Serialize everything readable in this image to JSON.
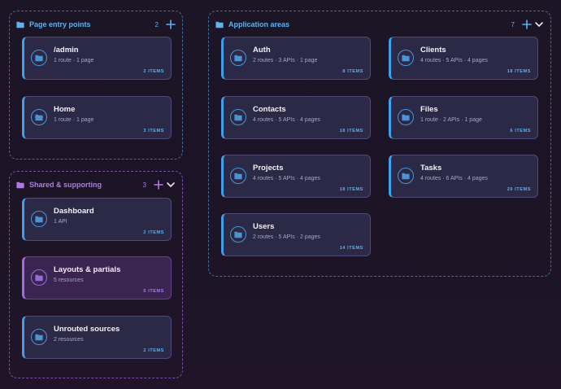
{
  "colors": {
    "blue_accent": "#5fb2ec",
    "purple_accent": "#b07ae6",
    "card_bg": "#2c2947"
  },
  "groups": {
    "entry": {
      "title": "Page entry points",
      "count": "2",
      "icon": "folder-icon",
      "cards": [
        {
          "title": "/admin",
          "subtitle": "1 route · 1 page",
          "items": "2 ITEMS"
        },
        {
          "title": "Home",
          "subtitle": "1 route · 1 page",
          "items": "3 ITEMS"
        }
      ]
    },
    "shared": {
      "title": "Shared & supporting",
      "count": "3",
      "icon": "folder-icon",
      "cards": [
        {
          "title": "Dashboard",
          "subtitle": "1 API",
          "items": "2 ITEMS"
        },
        {
          "title": "Layouts & partials",
          "subtitle": "5 resources",
          "items": "5 ITEMS"
        },
        {
          "title": "Unrouted sources",
          "subtitle": "2 resources",
          "items": "2 ITEMS"
        }
      ]
    },
    "app": {
      "title": "Application areas",
      "count": "7",
      "icon": "folder-icon",
      "cards": [
        {
          "title": "Auth",
          "subtitle": "2 routes · 3 APIs · 1 page",
          "items": "8 ITEMS"
        },
        {
          "title": "Clients",
          "subtitle": "4 routes · 5 APIs · 4 pages",
          "items": "18 ITEMS"
        },
        {
          "title": "Contacts",
          "subtitle": "4 routes · 5 APIs · 4 pages",
          "items": "18 ITEMS"
        },
        {
          "title": "Files",
          "subtitle": "1 route · 2 APIs · 1 page",
          "items": "6 ITEMS"
        },
        {
          "title": "Projects",
          "subtitle": "4 routes · 5 APIs · 4 pages",
          "items": "18 ITEMS"
        },
        {
          "title": "Tasks",
          "subtitle": "4 routes · 6 APIs · 4 pages",
          "items": "20 ITEMS"
        },
        {
          "title": "Users",
          "subtitle": "2 routes · 5 APIs · 2 pages",
          "items": "14 ITEMS"
        }
      ]
    }
  }
}
